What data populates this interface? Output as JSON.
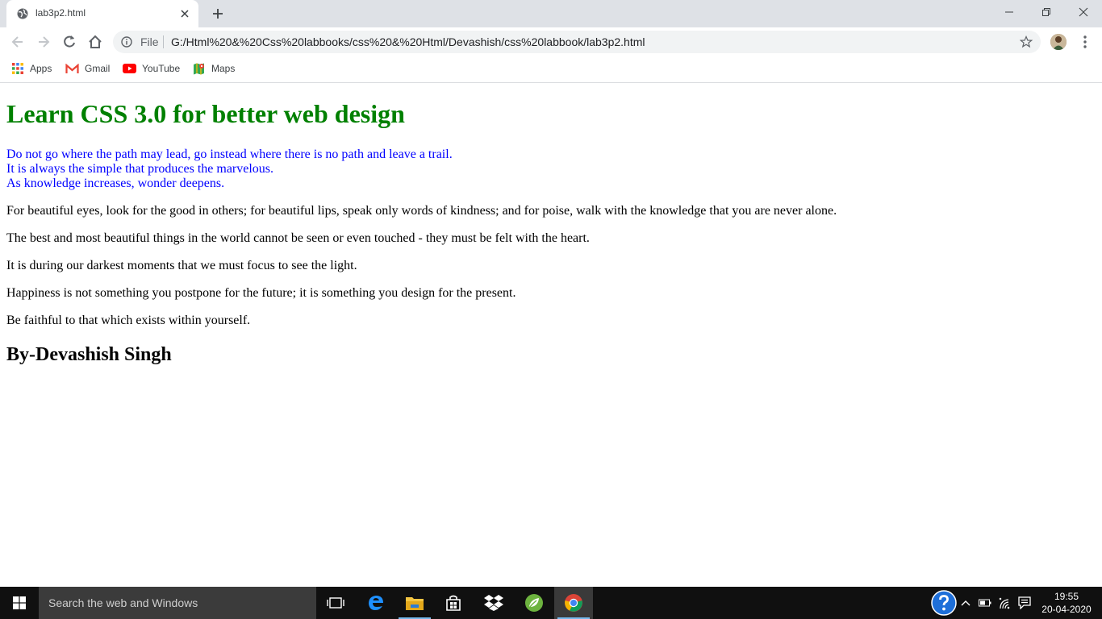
{
  "browser": {
    "tab_title": "lab3p2.html",
    "file_label": "File",
    "url": "G:/Html%20&%20Css%20labbooks/css%20&%20Html/Devashish/css%20labbook/lab3p2.html",
    "bookmarks": [
      {
        "label": "Apps",
        "icon": "apps-icon"
      },
      {
        "label": "Gmail",
        "icon": "gmail-icon"
      },
      {
        "label": "YouTube",
        "icon": "youtube-icon"
      },
      {
        "label": "Maps",
        "icon": "maps-icon"
      }
    ]
  },
  "page": {
    "heading": "Learn CSS 3.0 for better web design",
    "blue_lines": [
      "Do not go where the path may lead, go instead where there is no path and leave a trail.",
      "It is always the simple that produces the marvelous.",
      "As knowledge increases, wonder deepens."
    ],
    "paragraphs": [
      "For beautiful eyes, look for the good in others; for beautiful lips, speak only words of kindness; and for poise, walk with the knowledge that you are never alone.",
      "The best and most beautiful things in the world cannot be seen or even touched - they must be felt with the heart.",
      "It is during our darkest moments that we must focus to see the light.",
      "Happiness is not something you postpone for the future; it is something you design for the present.",
      "Be faithful to that which exists within yourself."
    ],
    "author": "By-Devashish Singh"
  },
  "taskbar": {
    "search_placeholder": "Search the web and Windows",
    "time": "19:55",
    "date": "20-04-2020"
  },
  "colors": {
    "heading": "#008000",
    "blue_text": "#0000ff",
    "taskbar": "#101010"
  }
}
